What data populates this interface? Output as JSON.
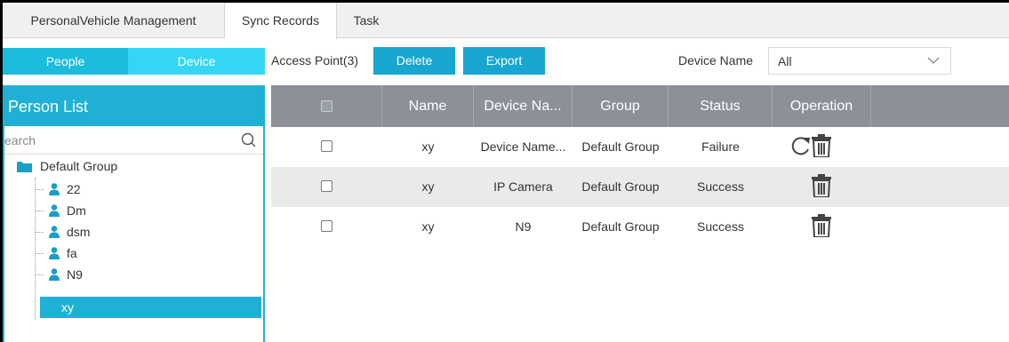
{
  "tabs": [
    {
      "label": "PersonalVehicle Management"
    },
    {
      "label": "Sync Records"
    },
    {
      "label": "Task"
    }
  ],
  "segments": {
    "people": "People",
    "device": "Device"
  },
  "person_list": {
    "title": "Person List",
    "search_placeholder": "earch",
    "group": "Default Group",
    "items": [
      {
        "label": "22"
      },
      {
        "label": "Dm"
      },
      {
        "label": "dsm"
      },
      {
        "label": "fa"
      },
      {
        "label": "N9"
      },
      {
        "label": "xy"
      }
    ]
  },
  "toolbar": {
    "access_point": "Access Point(3)",
    "delete_label": "Delete",
    "export_label": "Export",
    "device_name_label": "Device Name",
    "device_name_value": "All"
  },
  "table": {
    "columns": [
      "Name",
      "Device Na...",
      "Group",
      "Status",
      "Operation"
    ],
    "rows": [
      {
        "name": "xy",
        "device": "Device Name...",
        "group": "Default Group",
        "status": "Failure",
        "ops": [
          "refresh-icon",
          "trash-icon"
        ]
      },
      {
        "name": "xy",
        "device": "IP Camera",
        "group": "Default Group",
        "status": "Success",
        "ops": [
          "trash-icon"
        ]
      },
      {
        "name": "xy",
        "device": "N9",
        "group": "Default Group",
        "status": "Success",
        "ops": [
          "trash-icon"
        ]
      }
    ]
  },
  "colors": {
    "accent": "#21b0d5",
    "button": "#17a6d0",
    "header_gray": "#8b9099"
  }
}
